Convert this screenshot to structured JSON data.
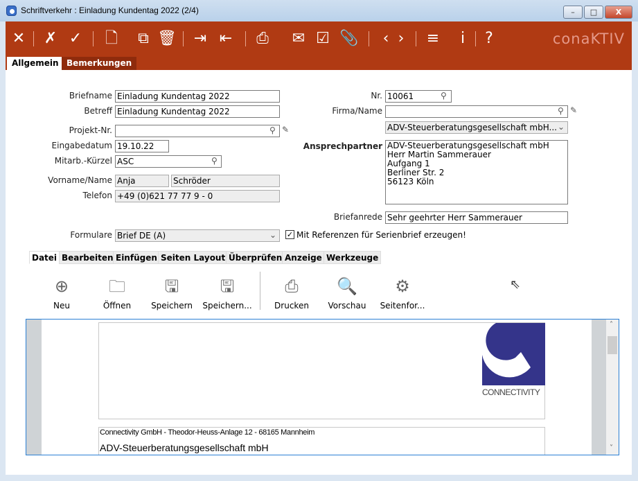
{
  "window": {
    "title": "Schriftverkehr : Einladung Kundentag 2022 (2/4)",
    "minimize": "–",
    "maximize": "□",
    "close": "X"
  },
  "toolbar": {
    "icons": [
      "close-icon",
      "discard-icon",
      "confirm-icon",
      "new-document-icon",
      "copy-icon",
      "delete-icon",
      "import-icon",
      "export-icon",
      "print-icon",
      "mail-icon",
      "checkbox-icon",
      "attachment-icon",
      "prev-icon",
      "next-icon",
      "menu-icon",
      "info-icon",
      "help-icon"
    ],
    "logo": "conaKTIV",
    "brand_color": "#b03a13"
  },
  "tabs": [
    "Allgemein",
    "Bemerkungen"
  ],
  "form": {
    "briefname_label": "Briefname",
    "briefname": "Einladung Kundentag 2022",
    "betreff_label": "Betreff",
    "betreff": "Einladung Kundentag 2022",
    "projekt_label": "Projekt-Nr.",
    "projekt": "",
    "eingabedatum_label": "Eingabedatum",
    "eingabedatum": "19.10.22",
    "mitarb_label": "Mitarb.-Kürzel",
    "mitarb": "ASC",
    "vorname_label": "Vorname/Name",
    "vorname": "Anja",
    "name": "Schröder",
    "telefon_label": "Telefon",
    "telefon": "+49 (0)621 77 77 9 - 0",
    "nr_label": "Nr.",
    "nr": "10061",
    "firma_label": "Firma/Name",
    "firma": "",
    "firma_select": "ADV-Steuerberatungsgesellschaft mbH...",
    "ansprech_label": "Ansprechpartner",
    "ansprech_lines": [
      "ADV-Steuerberatungsgesellschaft mbH",
      "Herr Martin Sammerauer",
      "Aufgang 1",
      "Berliner Str. 2",
      "56123 Köln"
    ],
    "briefanrede_label": "Briefanrede",
    "briefanrede": "Sehr geehrter Herr Sammerauer",
    "formulare_label": "Formulare",
    "formulare": "Brief DE (A)",
    "referenzen_label": "Mit Referenzen für Serienbrief erzeugen!",
    "referenzen_checked": true
  },
  "ribbon": {
    "tabs": [
      "Datei",
      "Bearbeiten",
      "Einfügen",
      "Seiten Layout",
      "Überprüfen",
      "Anzeige",
      "Werkzeuge"
    ],
    "buttons": [
      "Neu",
      "Öffnen",
      "Speichern",
      "Speichern...",
      "Drucken",
      "Vorschau",
      "Seitenfor..."
    ]
  },
  "document": {
    "logo_text": "CONNECTIVITY",
    "logo_color": "#34348a",
    "sender_line": "Connectivity GmbH - Theodor-Heuss-Anlage 12 - 68165 Mannheim",
    "recipient": "ADV-Steuerberatungsgesellschaft mbH"
  }
}
